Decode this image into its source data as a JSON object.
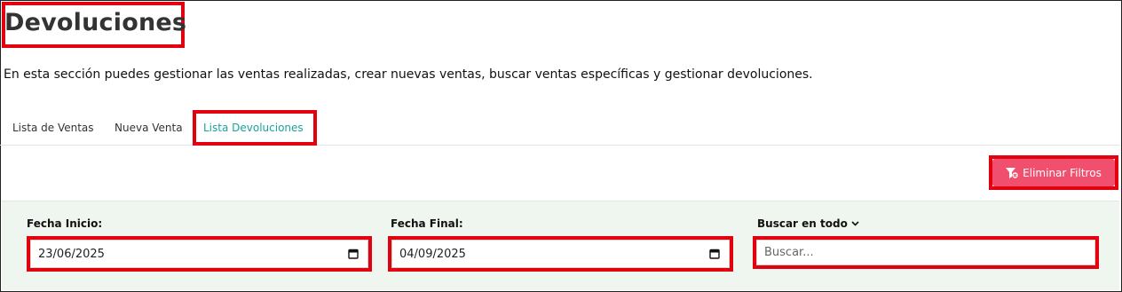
{
  "page": {
    "title": "Devoluciones",
    "description": "En esta sección puedes gestionar las ventas realizadas, crear nuevas ventas, buscar ventas específicas y gestionar devoluciones."
  },
  "tabs": [
    {
      "label": "Lista de Ventas"
    },
    {
      "label": "Nueva Venta"
    },
    {
      "label": "Lista Devoluciones",
      "active": true
    }
  ],
  "toolbar": {
    "clear_filters_label": "Eliminar Filtros",
    "clear_filters_icon": "filter-remove-icon"
  },
  "filters": {
    "start_date_label": "Fecha Inicio:",
    "start_date_value": "23/06/2025",
    "end_date_label": "Fecha Final:",
    "end_date_value": "04/09/2025",
    "search_scope_label": "Buscar en todo",
    "search_placeholder": "Buscar..."
  },
  "colors": {
    "active_tab": "#1aa39a",
    "danger_button": "#f0506e",
    "filter_panel": "#eef6ef",
    "highlight": "#e3000f"
  }
}
